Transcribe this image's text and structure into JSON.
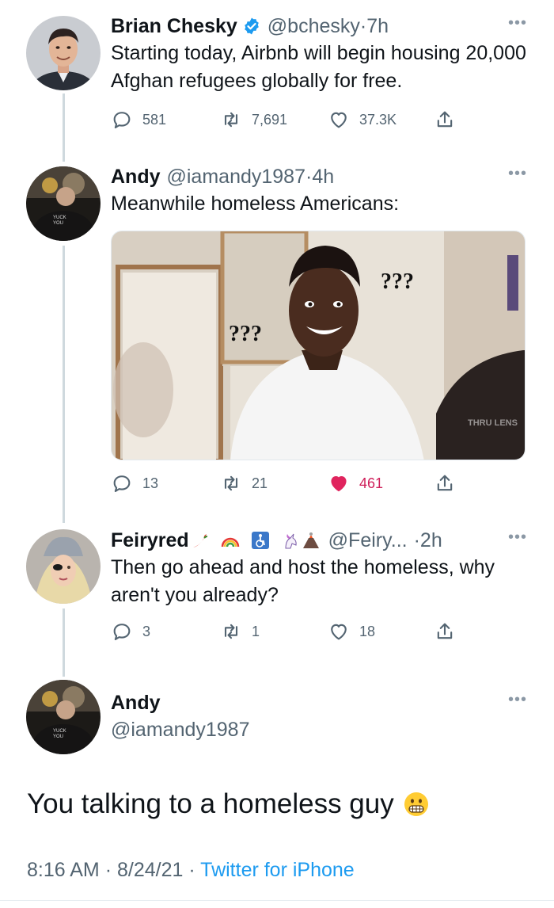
{
  "colors": {
    "text": "#0f1419",
    "secondary": "#536471",
    "link": "#1d9bf0",
    "like": "#f91880",
    "verified": "#1d9bf0"
  },
  "tweets": [
    {
      "name": "Brian Chesky",
      "verified": true,
      "handle": "@bchesky",
      "separator": "·",
      "time": "7h",
      "text": "Starting today, Airbnb will begin housing 20,000 Afghan refugees globally for free.",
      "reply_count": "581",
      "retweet_count": "7,691",
      "like_count": "37.3K",
      "liked": false
    },
    {
      "name": "Andy",
      "handle": "@iamandy1987",
      "separator": "·",
      "time": "4h",
      "text": "Meanwhile homeless Americans:",
      "media": {
        "caption_left": "???",
        "caption_right": "???",
        "watermark": "THRU LENS"
      },
      "reply_count": "13",
      "retweet_count": "21",
      "like_count": "461",
      "liked": true
    },
    {
      "name": "Feiryred",
      "name_emojis": [
        "hot-pepper",
        "rainbow",
        "wheelchair-symbol",
        "unicorn",
        "volcano"
      ],
      "handle": "@Feiry...",
      "separator": "·",
      "time": "2h",
      "text": "Then go ahead and host the homeless, why aren't you already?",
      "reply_count": "3",
      "retweet_count": "1",
      "like_count": "18",
      "liked": false
    }
  ],
  "main_tweet": {
    "name": "Andy",
    "handle": "@iamandy1987",
    "text": "You talking to a homeless guy",
    "emoji": "grimacing-face",
    "time": "8:16 AM",
    "separator": "·",
    "date": "8/24/21",
    "separator2": "·",
    "source": "Twitter for iPhone"
  },
  "avatar_shirt_text": "YUCK YOU",
  "more_label": "•••"
}
